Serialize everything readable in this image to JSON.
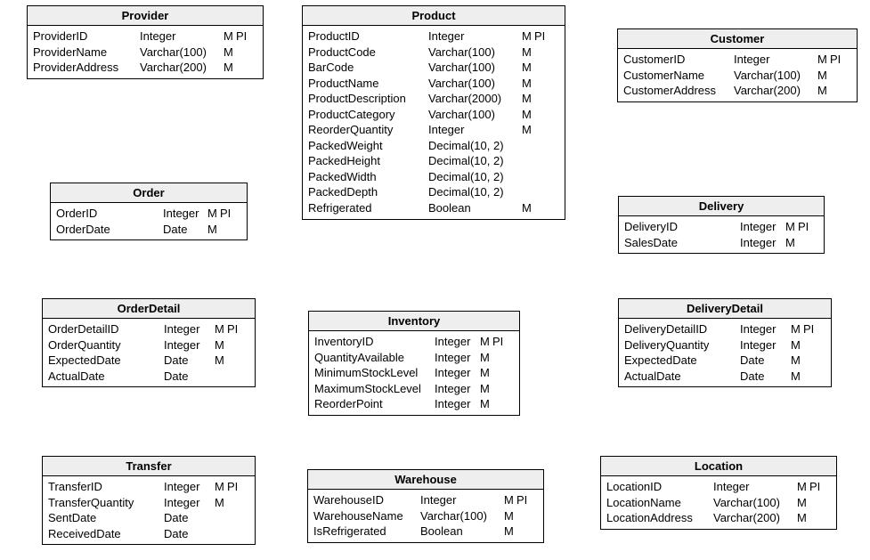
{
  "entities": {
    "provider": {
      "title": "Provider",
      "rows": [
        {
          "name": "ProviderID",
          "type": "Integer",
          "m": "M",
          "pi": "PI"
        },
        {
          "name": "ProviderName",
          "type": "Varchar(100)",
          "m": "M",
          "pi": ""
        },
        {
          "name": "ProviderAddress",
          "type": "Varchar(200)",
          "m": "M",
          "pi": ""
        }
      ]
    },
    "product": {
      "title": "Product",
      "rows": [
        {
          "name": "ProductID",
          "type": "Integer",
          "m": "M",
          "pi": "PI"
        },
        {
          "name": "ProductCode",
          "type": "Varchar(100)",
          "m": "M",
          "pi": ""
        },
        {
          "name": "BarCode",
          "type": "Varchar(100)",
          "m": "M",
          "pi": ""
        },
        {
          "name": "ProductName",
          "type": "Varchar(100)",
          "m": "M",
          "pi": ""
        },
        {
          "name": "ProductDescription",
          "type": "Varchar(2000)",
          "m": "M",
          "pi": ""
        },
        {
          "name": "ProductCategory",
          "type": "Varchar(100)",
          "m": "M",
          "pi": ""
        },
        {
          "name": "ReorderQuantity",
          "type": "Integer",
          "m": "M",
          "pi": ""
        },
        {
          "name": "PackedWeight",
          "type": "Decimal(10, 2)",
          "m": "",
          "pi": ""
        },
        {
          "name": "PackedHeight",
          "type": "Decimal(10, 2)",
          "m": "",
          "pi": ""
        },
        {
          "name": "PackedWidth",
          "type": "Decimal(10, 2)",
          "m": "",
          "pi": ""
        },
        {
          "name": "PackedDepth",
          "type": "Decimal(10, 2)",
          "m": "",
          "pi": ""
        },
        {
          "name": "Refrigerated",
          "type": "Boolean",
          "m": "M",
          "pi": ""
        }
      ]
    },
    "customer": {
      "title": "Customer",
      "rows": [
        {
          "name": "CustomerID",
          "type": "Integer",
          "m": "M",
          "pi": "PI"
        },
        {
          "name": "CustomerName",
          "type": "Varchar(100)",
          "m": "M",
          "pi": ""
        },
        {
          "name": "CustomerAddress",
          "type": "Varchar(200)",
          "m": "M",
          "pi": ""
        }
      ]
    },
    "order": {
      "title": "Order",
      "rows": [
        {
          "name": "OrderID",
          "type": "Integer",
          "m": "M",
          "pi": "PI"
        },
        {
          "name": "OrderDate",
          "type": "Date",
          "m": "M",
          "pi": ""
        }
      ]
    },
    "delivery": {
      "title": "Delivery",
      "rows": [
        {
          "name": "DeliveryID",
          "type": "Integer",
          "m": "M",
          "pi": "PI"
        },
        {
          "name": "SalesDate",
          "type": "Integer",
          "m": "M",
          "pi": ""
        }
      ]
    },
    "orderdetail": {
      "title": "OrderDetail",
      "rows": [
        {
          "name": "OrderDetailID",
          "type": "Integer",
          "m": "M",
          "pi": "PI"
        },
        {
          "name": "OrderQuantity",
          "type": "Integer",
          "m": "M",
          "pi": ""
        },
        {
          "name": "ExpectedDate",
          "type": "Date",
          "m": "M",
          "pi": ""
        },
        {
          "name": "ActualDate",
          "type": "Date",
          "m": "",
          "pi": ""
        }
      ]
    },
    "inventory": {
      "title": "Inventory",
      "rows": [
        {
          "name": "InventoryID",
          "type": "Integer",
          "m": "M",
          "pi": "PI"
        },
        {
          "name": "QuantityAvailable",
          "type": "Integer",
          "m": "M",
          "pi": ""
        },
        {
          "name": "MinimumStockLevel",
          "type": "Integer",
          "m": "M",
          "pi": ""
        },
        {
          "name": "MaximumStockLevel",
          "type": "Integer",
          "m": "M",
          "pi": ""
        },
        {
          "name": "ReorderPoint",
          "type": "Integer",
          "m": "M",
          "pi": ""
        }
      ]
    },
    "deliverydetail": {
      "title": "DeliveryDetail",
      "rows": [
        {
          "name": "DeliveryDetailID",
          "type": "Integer",
          "m": "M",
          "pi": "PI"
        },
        {
          "name": "DeliveryQuantity",
          "type": "Integer",
          "m": "M",
          "pi": ""
        },
        {
          "name": "ExpectedDate",
          "type": "Date",
          "m": "M",
          "pi": ""
        },
        {
          "name": "ActualDate",
          "type": "Date",
          "m": "M",
          "pi": ""
        }
      ]
    },
    "transfer": {
      "title": "Transfer",
      "rows": [
        {
          "name": "TransferID",
          "type": "Integer",
          "m": "M",
          "pi": "PI"
        },
        {
          "name": "TransferQuantity",
          "type": "Integer",
          "m": "M",
          "pi": ""
        },
        {
          "name": "SentDate",
          "type": "Date",
          "m": "",
          "pi": ""
        },
        {
          "name": "ReceivedDate",
          "type": "Date",
          "m": "",
          "pi": ""
        }
      ]
    },
    "warehouse": {
      "title": "Warehouse",
      "rows": [
        {
          "name": "WarehouseID",
          "type": "Integer",
          "m": "M",
          "pi": "PI"
        },
        {
          "name": "WarehouseName",
          "type": "Varchar(100)",
          "m": "M",
          "pi": ""
        },
        {
          "name": "IsRefrigerated",
          "type": "Boolean",
          "m": "M",
          "pi": ""
        }
      ]
    },
    "location": {
      "title": "Location",
      "rows": [
        {
          "name": "LocationID",
          "type": "Integer",
          "m": "M",
          "pi": "PI"
        },
        {
          "name": "LocationName",
          "type": "Varchar(100)",
          "m": "M",
          "pi": ""
        },
        {
          "name": "LocationAddress",
          "type": "Varchar(200)",
          "m": "M",
          "pi": ""
        }
      ]
    }
  }
}
